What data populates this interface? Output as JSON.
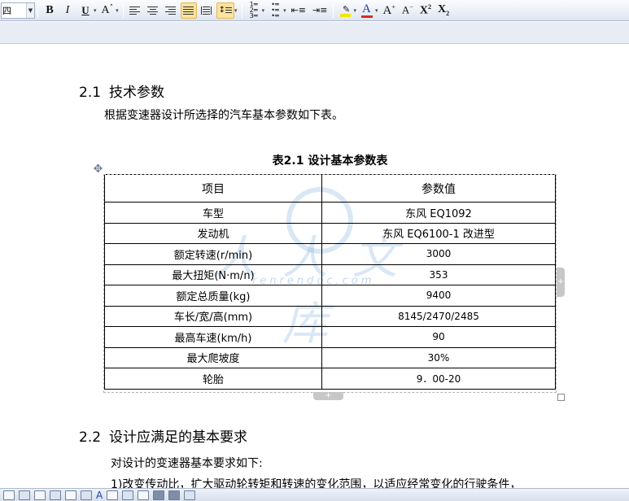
{
  "toolbar": {
    "font_size_value": "四",
    "bold_label": "B",
    "italic_label": "I",
    "underline_label": "U",
    "font_color_glyph": "A",
    "grow_font_glyph": "A",
    "shrink_font_glyph": "A",
    "superscript_glyph": "X",
    "subscript_glyph": "X",
    "superscript_mark": "2",
    "subscript_mark": "2",
    "dropdown_glyph": "▾",
    "colors": {
      "highlight": "#f2e600",
      "font_color": "#d62d20",
      "active_bg": "#fbe3a0"
    }
  },
  "document": {
    "section1": {
      "num": "2.1",
      "title": "技术参数"
    },
    "intro": "根据变速器设计所选择的汽车基本参数如下表。",
    "table_caption": "表2.1 设计基本参数表",
    "table": {
      "headers": [
        "项目",
        "参数值"
      ],
      "rows": [
        [
          "车型",
          "东风 EQ1092"
        ],
        [
          "发动机",
          "东风 EQ6100-1 改进型"
        ],
        [
          "额定转速(r/min)",
          "3000"
        ],
        [
          "最大扭矩(N·m/n)",
          "353"
        ],
        [
          "额定总质量(kg)",
          "9400"
        ],
        [
          "车长/宽/高(mm)",
          "8145/2470/2485"
        ],
        [
          "最高车速(km/h)",
          "90"
        ],
        [
          "最大爬坡度",
          "30%"
        ],
        [
          "轮胎",
          "9．00-20"
        ]
      ]
    },
    "section2": {
      "num": "2.2",
      "title": "设计应满足的基本要求"
    },
    "req_intro": "对设计的变速器基本要求如下:",
    "req_1": "1)改变传动比，扩大驱动轮转矩和转速的变化范围，以适应经常变化的行驶条件，"
  },
  "table_handles": {
    "add_row": "+",
    "add_col": "+",
    "move": "✥"
  },
  "watermark": {
    "text": "人人文库",
    "url": "renrendoc.com"
  },
  "bottom_toolbar": {
    "font_color_glyph": "A"
  }
}
